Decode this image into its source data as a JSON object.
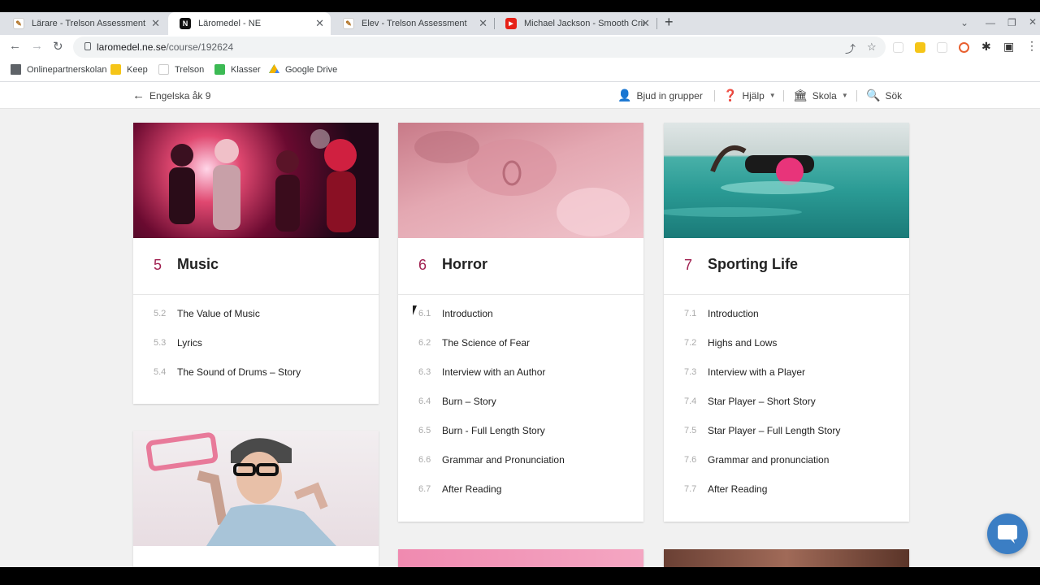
{
  "browser": {
    "tabs": [
      {
        "title": "Lärare - Trelson Assessment",
        "active": false
      },
      {
        "title": "Läromedel - NE",
        "active": true
      },
      {
        "title": "Elev - Trelson Assessment",
        "active": false
      },
      {
        "title": "Michael Jackson - Smooth Crimi",
        "active": false
      }
    ],
    "url_host": "laromedel.ne.se",
    "url_path": "/course/192624",
    "bookmarks": [
      "Onlinepartnerskolan",
      "Keep",
      "Trelson",
      "Klasser",
      "Google Drive"
    ]
  },
  "header": {
    "back_label": "Engelska åk 9",
    "invite_label": "Bjud in grupper",
    "help_label": "Hjälp",
    "school_label": "Skola",
    "search_label": "Sök"
  },
  "chapters": [
    {
      "num": "5",
      "title": "Music",
      "items": [
        {
          "num": "5.2",
          "title": "The Value of Music"
        },
        {
          "num": "5.3",
          "title": "Lyrics"
        },
        {
          "num": "5.4",
          "title": "The Sound of Drums – Story"
        }
      ]
    },
    {
      "num": "6",
      "title": "Horror",
      "items": [
        {
          "num": "6.1",
          "title": "Introduction"
        },
        {
          "num": "6.2",
          "title": "The Science of Fear"
        },
        {
          "num": "6.3",
          "title": "Interview with an Author"
        },
        {
          "num": "6.4",
          "title": "Burn – Story"
        },
        {
          "num": "6.5",
          "title": "Burn - Full Length Story"
        },
        {
          "num": "6.6",
          "title": "Grammar and Pronunciation"
        },
        {
          "num": "6.7",
          "title": "After Reading"
        }
      ]
    },
    {
      "num": "7",
      "title": "Sporting Life",
      "items": [
        {
          "num": "7.1",
          "title": "Introduction"
        },
        {
          "num": "7.2",
          "title": "Highs and Lows"
        },
        {
          "num": "7.3",
          "title": "Interview with a Player"
        },
        {
          "num": "7.4",
          "title": "Star Player – Short Story"
        },
        {
          "num": "7.5",
          "title": "Star Player – Full Length Story"
        },
        {
          "num": "7.6",
          "title": "Grammar and pronunciation"
        },
        {
          "num": "7.7",
          "title": "After Reading"
        }
      ]
    }
  ],
  "colors": {
    "accent": "#a02050",
    "chat": "#3b7ec4"
  }
}
